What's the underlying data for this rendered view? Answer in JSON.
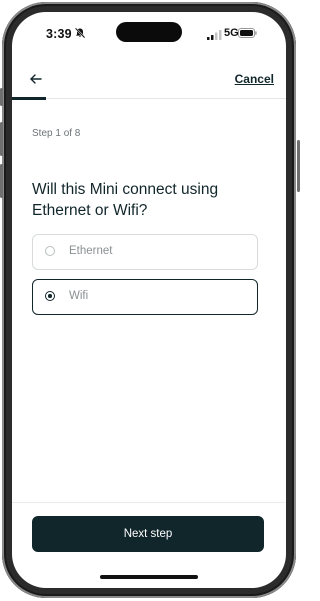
{
  "status_bar": {
    "time": "3:39",
    "network": "5G",
    "icons": [
      "bell-muted-icon",
      "signal-icon",
      "battery-icon"
    ]
  },
  "nav": {
    "back_icon": "arrow-left-icon",
    "cancel_label": "Cancel"
  },
  "progress": {
    "step_text": "Step 1 of 8",
    "fraction": 0.125
  },
  "question": "Will this Mini connect using Ethernet or Wifi?",
  "options": [
    {
      "label": "Ethernet",
      "selected": false
    },
    {
      "label": "Wifi",
      "selected": true
    }
  ],
  "footer": {
    "next_label": "Next step"
  },
  "colors": {
    "primary": "#11262b",
    "muted_text": "#8a9092",
    "border": "#d8dbdc"
  }
}
